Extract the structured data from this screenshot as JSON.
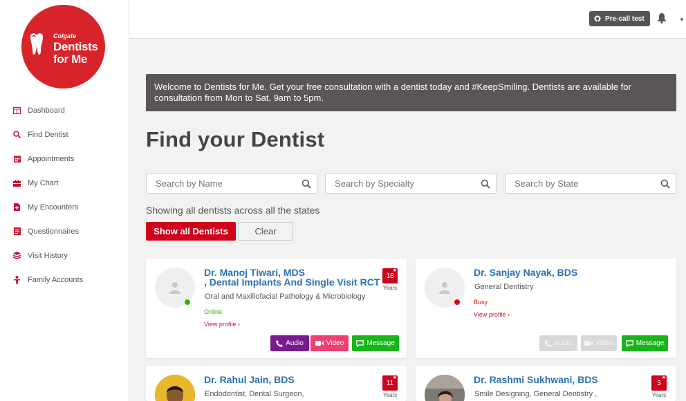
{
  "logo": {
    "brand_small": "Colgate",
    "line1": "Dentists",
    "line2": "for Me"
  },
  "sidebar": {
    "items": [
      {
        "label": "Dashboard",
        "icon": "dashboard-icon"
      },
      {
        "label": "Find Dentist",
        "icon": "search-icon"
      },
      {
        "label": "Appointments",
        "icon": "calendar-icon"
      },
      {
        "label": "My Chart",
        "icon": "chart-icon"
      },
      {
        "label": "My Encounters",
        "icon": "document-plus-icon"
      },
      {
        "label": "Questionnaires",
        "icon": "questionnaire-icon"
      },
      {
        "label": "Visit History",
        "icon": "history-stack-icon"
      },
      {
        "label": "Family Accounts",
        "icon": "family-icon"
      }
    ]
  },
  "topbar": {
    "precall_label": "Pre-call test"
  },
  "banner": {
    "text": "Welcome to Dentists for Me. Get your free consultation with a dentist today and #KeepSmiling. Dentists are available for consultation from Mon to Sat, 9am to 5pm."
  },
  "page": {
    "title": "Find your Dentist"
  },
  "search": {
    "name_placeholder": "Search by Name",
    "specialty_placeholder": "Search by Specialty",
    "state_placeholder": "Search by State"
  },
  "filters": {
    "showing_text": "Showing all dentists across all the states",
    "show_all_label": "Show all Dentists",
    "clear_label": "Clear"
  },
  "dentists": [
    {
      "name_line1": "Dr. Manoj Tiwari, MDS",
      "name_line2": ", Dental Implants And Single Visit RCT",
      "specialty": "Oral and Maxillofacial Pathology & Microbiology",
      "status": "Online",
      "view_profile": "View profile ›",
      "years": "18",
      "years_label": "Years",
      "actions": {
        "audio": "Audio",
        "video": "Video",
        "message": "Message"
      }
    },
    {
      "name_line1": "Dr. Sanjay Nayak, BDS",
      "specialty": "General Dentistry",
      "status": "Busy",
      "view_profile": "View profile ›",
      "actions": {
        "audio": "Audio",
        "video": "Video",
        "message": "Message"
      }
    },
    {
      "name_line1": "Dr. Rahul Jain, BDS",
      "specialty": "Endodontist,  Dental Surgeon,",
      "years": "11",
      "years_label": "Years"
    },
    {
      "name_line1": "Dr. Rashmi Sukhwani, BDS",
      "specialty": "Smile Designing,  General Dentistry ,",
      "years": "3",
      "years_label": "Years"
    }
  ],
  "colors": {
    "brand_red": "#d9232a",
    "button_red": "#d0021b",
    "link_blue": "#2a6fb5",
    "online_green": "#2db300",
    "busy_red": "#e00000",
    "audio_purple": "#7a1a8e",
    "video_pink": "#ef3f6e",
    "message_green": "#18b51a",
    "disabled_gray": "#d8d8d8",
    "banner_bg": "#5a5655"
  }
}
